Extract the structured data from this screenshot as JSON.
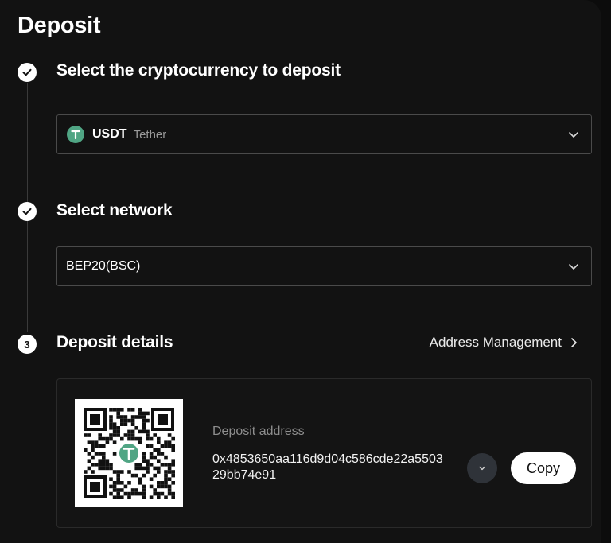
{
  "page": {
    "title": "Deposit"
  },
  "steps": [
    {
      "marker": "check",
      "title": "Select the cryptocurrency to deposit",
      "select": {
        "symbol": "USDT",
        "name": "Tether",
        "icon": "tether-icon",
        "icon_letter": "T",
        "icon_color": "#50a584"
      }
    },
    {
      "marker": "check",
      "title": "Select network",
      "select": {
        "value": "BEP20(BSC)"
      }
    },
    {
      "marker": "3",
      "title": "Deposit details",
      "link": "Address Management"
    }
  ],
  "deposit": {
    "address_label": "Deposit address",
    "address": "0x4853650aa116d9d04c586cde22a550329bb74e91",
    "qr_center_letter": "T",
    "copy_label": "Copy"
  },
  "colors": {
    "background": "#121212",
    "border": "#4a4a4a",
    "accent_tether": "#50a584",
    "muted_text": "#8e8e8e"
  }
}
